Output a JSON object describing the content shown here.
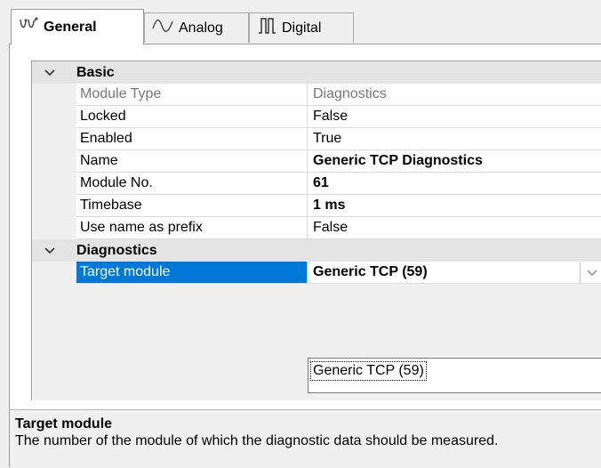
{
  "tabs": [
    {
      "label": "General",
      "icon": "general-wave-icon"
    },
    {
      "label": "Analog",
      "icon": "analog-wave-icon"
    },
    {
      "label": "Digital",
      "icon": "digital-pulse-icon"
    }
  ],
  "grid": {
    "categories": [
      {
        "label": "Basic",
        "properties": [
          {
            "name": "Module Type",
            "value": "Diagnostics"
          },
          {
            "name": "Locked",
            "value": "False"
          },
          {
            "name": "Enabled",
            "value": "True"
          },
          {
            "name": "Name",
            "value": "Generic TCP Diagnostics"
          },
          {
            "name": "Module No.",
            "value": "61"
          },
          {
            "name": "Timebase",
            "value": "1 ms"
          },
          {
            "name": "Use name as prefix",
            "value": "False"
          }
        ]
      },
      {
        "label": "Diagnostics",
        "properties": [
          {
            "name": "Target module",
            "value": "Generic TCP (59)"
          }
        ]
      }
    ],
    "dropdown_options": [
      "Generic TCP (59)"
    ]
  },
  "description": {
    "title": "Target module",
    "text": "The number of the module of which the diagnostic data should be measured."
  },
  "colors": {
    "selection": "#0078d7",
    "background": "#f0f0f0",
    "grid_background": "#ffffff"
  }
}
